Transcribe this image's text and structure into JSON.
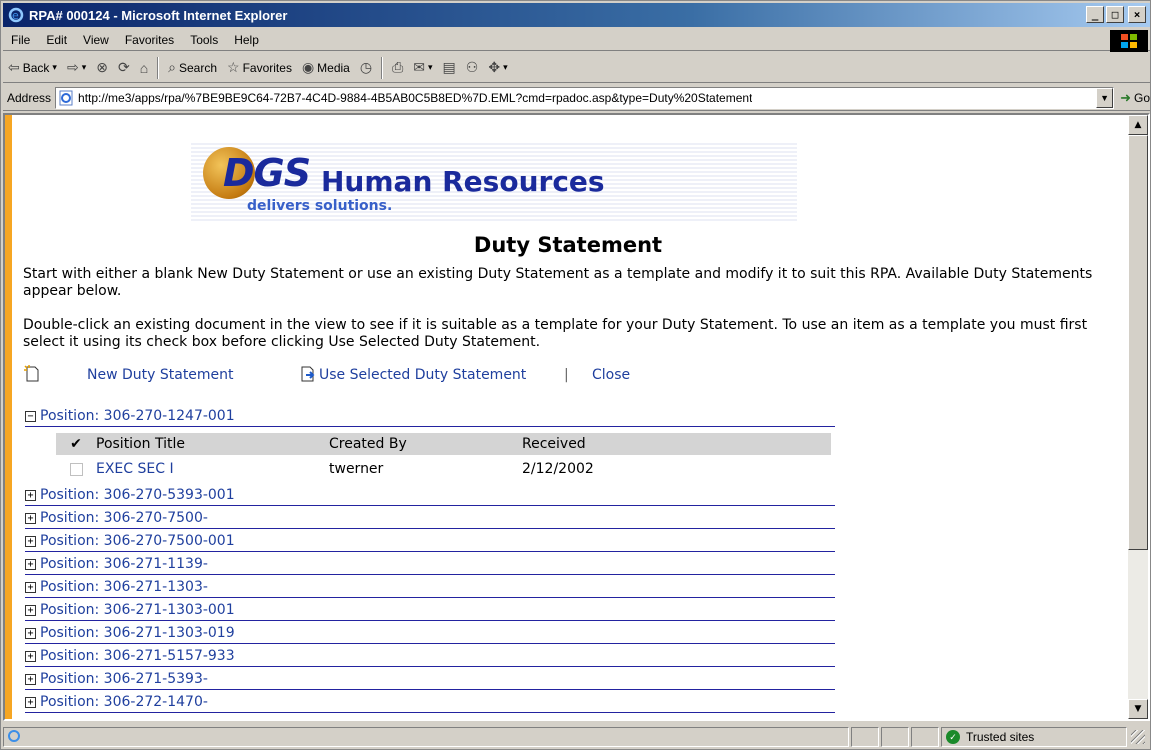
{
  "window": {
    "title": "RPA# 000124 - Microsoft Internet Explorer"
  },
  "menu": [
    "File",
    "Edit",
    "View",
    "Favorites",
    "Tools",
    "Help"
  ],
  "toolbar": {
    "back": "Back",
    "search": "Search",
    "favorites": "Favorites",
    "media": "Media"
  },
  "address": {
    "label": "Address",
    "url": "http://me3/apps/rpa/%7BE9BE9C64-72B7-4C4D-9884-4B5AB0C5B8ED%7D.EML?cmd=rpadoc.asp&type=Duty%20Statement",
    "go": "Go"
  },
  "banner": {
    "logo": "DGS",
    "name": "Human Resources",
    "tagline": "delivers solutions."
  },
  "page": {
    "heading": "Duty Statement",
    "intro1": "Start with either a blank New Duty Statement or use an existing Duty Statement as a template and modify it to suit this RPA. Available Duty Statements appear below.",
    "intro2": "Double-click an existing document in the view to see if it is suitable as a template for your Duty Statement. To use an item as a template you must first select it using its check box before clicking Use Selected Duty Statement."
  },
  "actions": {
    "new": "New Duty Statement",
    "use_selected": "Use Selected Duty Statement",
    "separator": "|",
    "close": "Close"
  },
  "table": {
    "check_header": "✔",
    "headers": [
      "Position Title",
      "Created By",
      "Received"
    ],
    "rows": [
      {
        "title": "EXEC SEC I",
        "created_by": "twerner",
        "received": "2/12/2002"
      }
    ]
  },
  "groups": [
    {
      "sign": "−",
      "label": "Position: 306-270-1247-001"
    },
    {
      "sign": "+",
      "label": "Position: 306-270-5393-001"
    },
    {
      "sign": "+",
      "label": "Position: 306-270-7500-"
    },
    {
      "sign": "+",
      "label": "Position: 306-270-7500-001"
    },
    {
      "sign": "+",
      "label": "Position: 306-271-1139-"
    },
    {
      "sign": "+",
      "label": "Position: 306-271-1303-"
    },
    {
      "sign": "+",
      "label": "Position: 306-271-1303-001"
    },
    {
      "sign": "+",
      "label": "Position: 306-271-1303-019"
    },
    {
      "sign": "+",
      "label": "Position: 306-271-5157-933"
    },
    {
      "sign": "+",
      "label": "Position: 306-271-5393-"
    },
    {
      "sign": "+",
      "label": "Position: 306-272-1470-"
    }
  ],
  "status": {
    "zone": "Trusted sites"
  },
  "colors": {
    "link": "#1f3f9e",
    "accent_bar": "#f6a623",
    "group_rule": "#2323a0"
  }
}
